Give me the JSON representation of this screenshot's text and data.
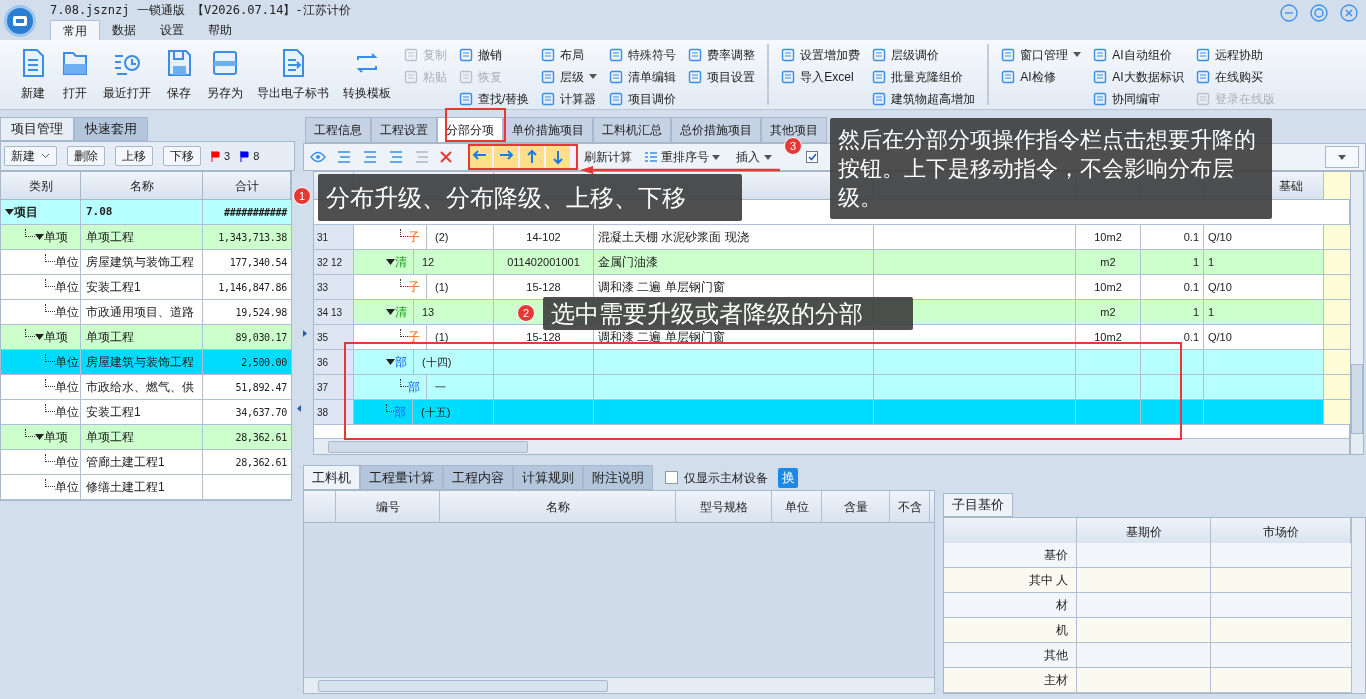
{
  "window": {
    "title": "7.08.jsznzj 一锁通版 【V2026.07.14】-江苏计价"
  },
  "menu_tabs": [
    {
      "label": "常用",
      "selected": true
    },
    {
      "label": "数据",
      "selected": false
    },
    {
      "label": "设置",
      "selected": false
    },
    {
      "label": "帮助",
      "selected": false
    }
  ],
  "ribbon": {
    "large_buttons": [
      "新建",
      "打开",
      "最近打开",
      "保存",
      "另存为",
      "导出电子标书",
      "转换模板"
    ],
    "columns": [
      [
        {
          "label": "复制",
          "disabled": true
        },
        {
          "label": "粘贴",
          "disabled": true
        }
      ],
      [
        {
          "label": "撤销",
          "disabled": false
        },
        {
          "label": "恢复",
          "disabled": true
        },
        {
          "label": "查找/替换",
          "disabled": false
        }
      ],
      [
        {
          "label": "布局",
          "disabled": false
        },
        {
          "label": "层级",
          "disabled": false,
          "dropdown": true
        },
        {
          "label": "计算器",
          "disabled": false
        }
      ],
      [
        {
          "label": "特殊符号",
          "disabled": false
        },
        {
          "label": "清单编辑",
          "disabled": false
        },
        {
          "label": "项目调价",
          "disabled": false
        }
      ],
      [
        {
          "label": "费率调整",
          "disabled": false
        },
        {
          "label": "项目设置",
          "disabled": false
        }
      ],
      [
        {
          "label": "设置增加费",
          "disabled": false,
          "separator_before": true
        },
        {
          "label": "导入Excel",
          "disabled": false
        }
      ],
      [
        {
          "label": "层级调价",
          "disabled": false
        },
        {
          "label": "批量克隆组价",
          "disabled": false
        },
        {
          "label": "建筑物超高增加",
          "disabled": false
        }
      ],
      [
        {
          "label": "窗口管理",
          "disabled": false,
          "dropdown": true,
          "separator_before": true
        },
        {
          "label": "AI检修",
          "disabled": false
        }
      ],
      [
        {
          "label": "AI自动组价",
          "disabled": false
        },
        {
          "label": "AI大数据标识",
          "disabled": false
        },
        {
          "label": "协同编审",
          "disabled": false
        }
      ],
      [
        {
          "label": "远程协助",
          "disabled": false
        },
        {
          "label": "在线购买",
          "disabled": false
        },
        {
          "label": "登录在线版",
          "disabled": true
        }
      ]
    ]
  },
  "left_panel": {
    "tabs": [
      {
        "label": "项目管理",
        "selected": true
      },
      {
        "label": "快速套用",
        "selected": false
      }
    ],
    "toolbar": {
      "buttons": [
        {
          "label": "新建",
          "dropdown": true
        },
        {
          "label": "删除"
        },
        {
          "label": "上移"
        },
        {
          "label": "下移"
        }
      ],
      "flags": [
        {
          "color": "#ff0000",
          "count": "3"
        },
        {
          "color": "#0000ff",
          "count": "8"
        }
      ]
    },
    "columns": [
      "类别",
      "名称",
      "合计"
    ],
    "tree": [
      {
        "type": "项目",
        "name": "7.08",
        "total": "###########",
        "selected": false,
        "children": [
          {
            "type": "单项",
            "name": "单项工程",
            "total": "1,343,713.38",
            "selected": false,
            "children": [
              {
                "type": "单位",
                "name": "房屋建筑与装饰工程",
                "total": "177,340.54",
                "selected": false
              },
              {
                "type": "单位",
                "name": "安装工程1",
                "total": "1,146,847.86",
                "selected": false
              },
              {
                "type": "单位",
                "name": "市政通用项目、道路",
                "total": "19,524.98",
                "selected": false
              }
            ]
          },
          {
            "type": "单项",
            "name": "单项工程",
            "total": "89,030.17",
            "selected": false,
            "children": [
              {
                "type": "单位",
                "name": "房屋建筑与装饰工程",
                "total": "2,500.00",
                "selected": true
              },
              {
                "type": "单位",
                "name": "市政给水、燃气、供",
                "total": "51,892.47",
                "selected": false
              },
              {
                "type": "单位",
                "name": "安装工程1",
                "total": "34,637.70",
                "selected": false
              }
            ]
          },
          {
            "type": "单项",
            "name": "单项工程",
            "total": "28,362.61",
            "selected": false,
            "children": [
              {
                "type": "单位",
                "name": "管廊土建工程1",
                "total": "28,362.61",
                "selected": false
              },
              {
                "type": "单位",
                "name": "修缮土建工程1",
                "selected": false
              }
            ]
          }
        ]
      }
    ]
  },
  "main_tabs": [
    {
      "label": "工程信息",
      "selected": false
    },
    {
      "label": "工程设置",
      "selected": false
    },
    {
      "label": "分部分项",
      "selected": true
    },
    {
      "label": "单价措施项目",
      "selected": false
    },
    {
      "label": "工料机汇总",
      "selected": false
    },
    {
      "label": "总价措施项目",
      "selected": false
    },
    {
      "label": "其他项目",
      "selected": false
    }
  ],
  "main_toolbar": {
    "refresh": "刷新计算",
    "renumber": "重排序号",
    "insert": "插入",
    "feature_checkbox": {
      "checked": true
    }
  },
  "grid": {
    "base_column_header": "基础",
    "rows": [
      {
        "num": "31",
        "kind": "子",
        "seq": "(2)",
        "code": "14-102",
        "name": "混凝土天棚 水泥砂浆面 现浇",
        "unit": "10m2",
        "qty": "0.1",
        "base": "Q/10",
        "selected": false
      },
      {
        "num": "32 12",
        "kind": "清",
        "seq": "12",
        "code": "011402001001",
        "name": "金属门油漆",
        "unit": "m2",
        "qty": "1",
        "base": "1",
        "selected": false,
        "children": [
          {
            "num": "33",
            "kind": "子",
            "seq": "(1)",
            "code": "15-128",
            "name": "调和漆 二遍 单层钢门窗",
            "unit": "10m2",
            "qty": "0.1",
            "base": "Q/10",
            "selected": false
          }
        ]
      },
      {
        "num": "34 13",
        "kind": "清",
        "seq": "13",
        "unit": "m2",
        "qty": "1",
        "base": "1",
        "selected": false,
        "children": [
          {
            "num": "35",
            "kind": "子",
            "seq": "(1)",
            "code": "15-128",
            "name": "调和漆 二遍 单层钢门窗",
            "unit": "10m2",
            "qty": "0.1",
            "base": "Q/10",
            "selected": false
          }
        ]
      },
      {
        "num": "36",
        "kind": "部",
        "seq": "(十四)",
        "selected": false,
        "children": [
          {
            "num": "37",
            "kind": "部",
            "seq": "一",
            "selected": false
          }
        ]
      },
      {
        "num": "38",
        "kind": "部",
        "seq": "(十五)",
        "selected": true
      }
    ]
  },
  "bottom": {
    "tabs": [
      {
        "label": "工料机",
        "selected": true
      },
      {
        "label": "工程量计算",
        "selected": false
      },
      {
        "label": "工程内容",
        "selected": false
      },
      {
        "label": "计算规则",
        "selected": false
      },
      {
        "label": "附注说明",
        "selected": false
      }
    ],
    "main_only_checkbox": {
      "label": "仅显示主材设备",
      "checked": false
    },
    "swap_button": "换",
    "columns": [
      "编号",
      "名称",
      "型号规格",
      "单位",
      "含量",
      "不含"
    ]
  },
  "price_panel": {
    "tab": "子目基价",
    "columns": [
      "基期价",
      "市场价"
    ],
    "rows": [
      "基价",
      "其中 人",
      "材",
      "机",
      "其他",
      "主材"
    ]
  },
  "annotations": [
    {
      "number": "1",
      "text": "分布升级、分布降级、上移、下移"
    },
    {
      "number": "2",
      "text": "选中需要升级或者降级的分部"
    },
    {
      "number": "3",
      "text": "然后在分部分项操作指令栏点击想要升降的按钮。上下是移动指令，不会影响分布层级。"
    }
  ]
}
